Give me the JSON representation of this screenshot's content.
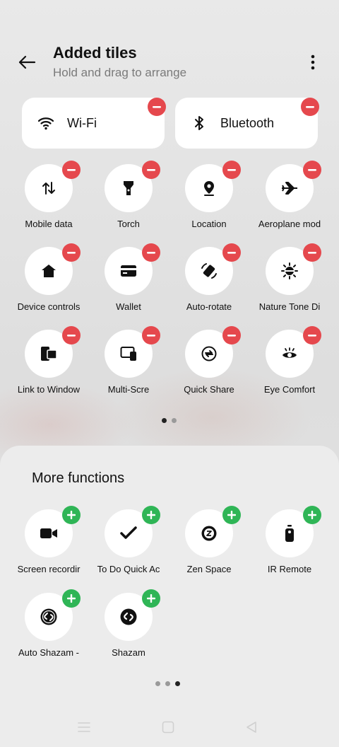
{
  "header": {
    "title": "Added tiles",
    "subtitle": "Hold and drag to arrange"
  },
  "wide_tiles": [
    {
      "label": "Wi-Fi",
      "icon": "wifi-icon"
    },
    {
      "label": "Bluetooth",
      "icon": "bluetooth-icon"
    }
  ],
  "added_tiles": [
    {
      "label": "Mobile data",
      "icon": "mobile-data-icon"
    },
    {
      "label": "Torch",
      "icon": "torch-icon"
    },
    {
      "label": "Location",
      "icon": "location-icon"
    },
    {
      "label": "Aeroplane mod",
      "icon": "airplane-icon"
    },
    {
      "label": "Device controls",
      "icon": "home-icon"
    },
    {
      "label": "Wallet",
      "icon": "wallet-icon"
    },
    {
      "label": "Auto-rotate",
      "icon": "auto-rotate-icon"
    },
    {
      "label": "Nature Tone Di",
      "icon": "nature-tone-icon"
    },
    {
      "label": "Link to Window",
      "icon": "link-to-windows-icon"
    },
    {
      "label": "Multi-Scre",
      "icon": "multi-screen-icon"
    },
    {
      "label": "Quick Share",
      "icon": "quick-share-icon"
    },
    {
      "label": "Eye Comfort",
      "icon": "eye-comfort-icon"
    }
  ],
  "added_pager": {
    "pages": 2,
    "active": 1
  },
  "more_functions": {
    "title": "More functions",
    "tiles": [
      {
        "label": "Screen recordir",
        "icon": "screen-recording-icon"
      },
      {
        "label": "To Do Quick Ac",
        "icon": "todo-icon"
      },
      {
        "label": "Zen Space",
        "icon": "zen-space-icon"
      },
      {
        "label": "IR Remote",
        "icon": "ir-remote-icon"
      },
      {
        "label": "Auto Shazam -",
        "icon": "shazam-icon"
      },
      {
        "label": "Shazam",
        "icon": "shazam-icon"
      }
    ],
    "pager": {
      "pages": 3,
      "active": 3
    }
  },
  "colors": {
    "remove": "#e5484d",
    "add": "#2fb556"
  }
}
